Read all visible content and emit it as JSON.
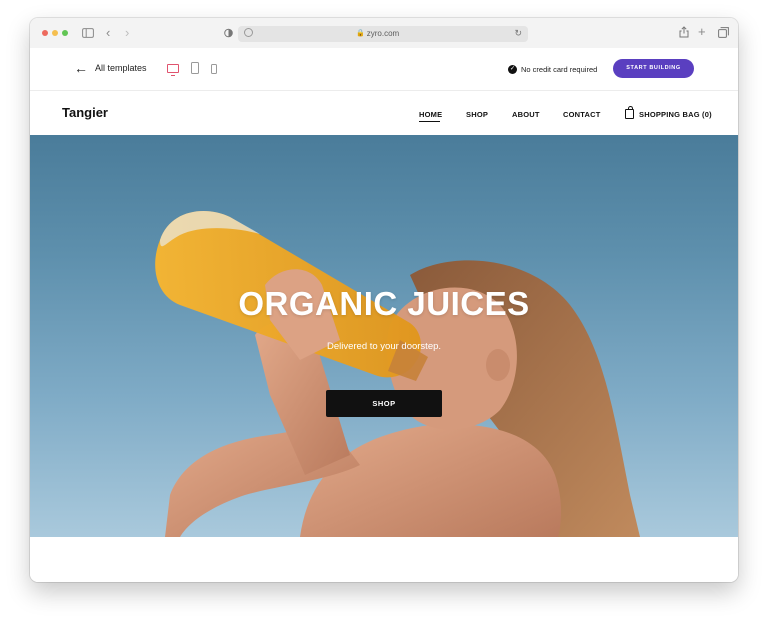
{
  "browser": {
    "url": "zyro.com",
    "lights": {
      "close": "#ed6a5e",
      "minimize": "#f5bf4f",
      "zoom": "#61c554"
    }
  },
  "toolbar": {
    "back_label": "All templates",
    "credit_note": "No credit card required",
    "start_button": "START BUILDING",
    "accent": "#5a3fc0",
    "active_device": "desktop"
  },
  "site": {
    "brand": "Tangier",
    "nav": {
      "home": "HOME",
      "shop": "SHOP",
      "about": "ABOUT",
      "contact": "CONTACT",
      "bag": "SHOPPING BAG (0)"
    }
  },
  "hero": {
    "title": "ORGANIC JUICES",
    "subtitle": "Delivered to your doorstep.",
    "button": "SHOP"
  }
}
